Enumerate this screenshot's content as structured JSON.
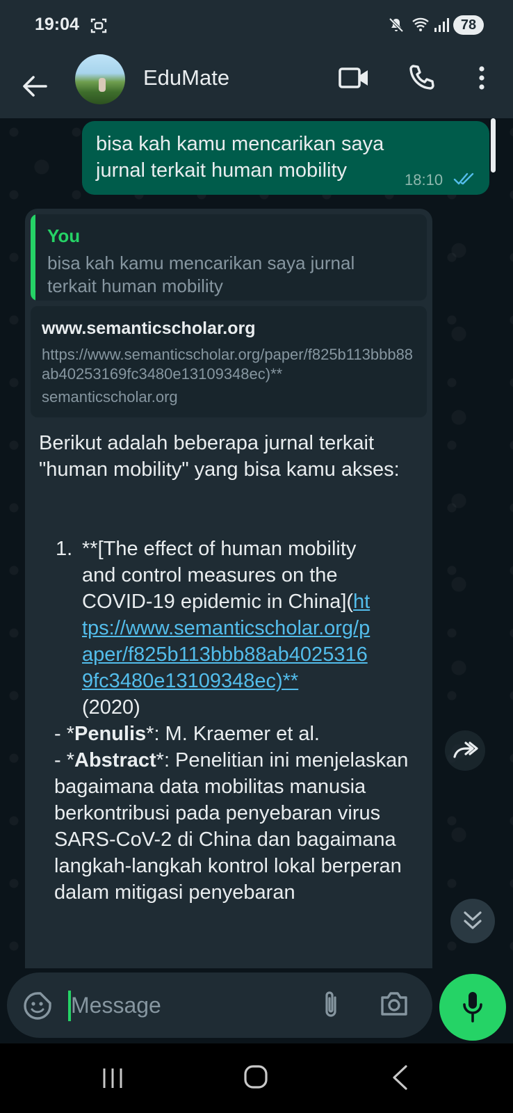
{
  "status_bar": {
    "time": "19:04",
    "battery": "78",
    "icons": [
      "screen-record-icon",
      "mute-icon",
      "wifi-icon",
      "signal-icon"
    ]
  },
  "header": {
    "contact_name": "EduMate",
    "icons": [
      "back-arrow-icon",
      "video-call-icon",
      "phone-call-icon",
      "more-options-icon"
    ]
  },
  "messages": {
    "outgoing": {
      "text": "bisa kah kamu mencarikan saya jurnal terkait human mobility",
      "time": "18:10",
      "status": "read"
    },
    "incoming": {
      "quote": {
        "author": "You",
        "text": "bisa kah kamu mencarikan saya jurnal terkait human mobility"
      },
      "link_preview": {
        "domain": "www.semanticscholar.org",
        "url": "https://www.semanticscholar.org/paper/f825b113bbb88ab40253169fc3480e13109348ec)**",
        "site": "semanticscholar.org"
      },
      "intro": "Berikut adalah beberapa jurnal terkait \"human mobility\" yang bisa kamu akses:",
      "item1": {
        "number": "1.",
        "text_before": "**[The effect of human mobility and control measures on the COVID-19 epidemic in China](",
        "link": "https://www.semanticscholar.org/paper/f825b113bbb88ab40253169fc3480e13109348ec)**",
        "text_after": "(2020)"
      },
      "author_line": {
        "prefix": "- *",
        "label": "Penulis",
        "suffix": "*: M. Kraemer et al."
      },
      "abstract_line": {
        "prefix": "- *",
        "label": "Abstract",
        "text": "*: Penelitian ini menjelaskan bagaimana data mobilitas manusia berkontribusi pada penyebaran virus SARS-CoV-2 di China dan bagaimana langkah-langkah kontrol lokal berperan dalam mitigasi penyebaran"
      }
    }
  },
  "input": {
    "placeholder": "Message"
  },
  "colors": {
    "background": "#0b141a",
    "bar": "#1f2c34",
    "outgoing_bubble": "#005c4b",
    "incoming_bubble": "#1f2c34",
    "accent": "#25d366",
    "link": "#53bdeb"
  }
}
